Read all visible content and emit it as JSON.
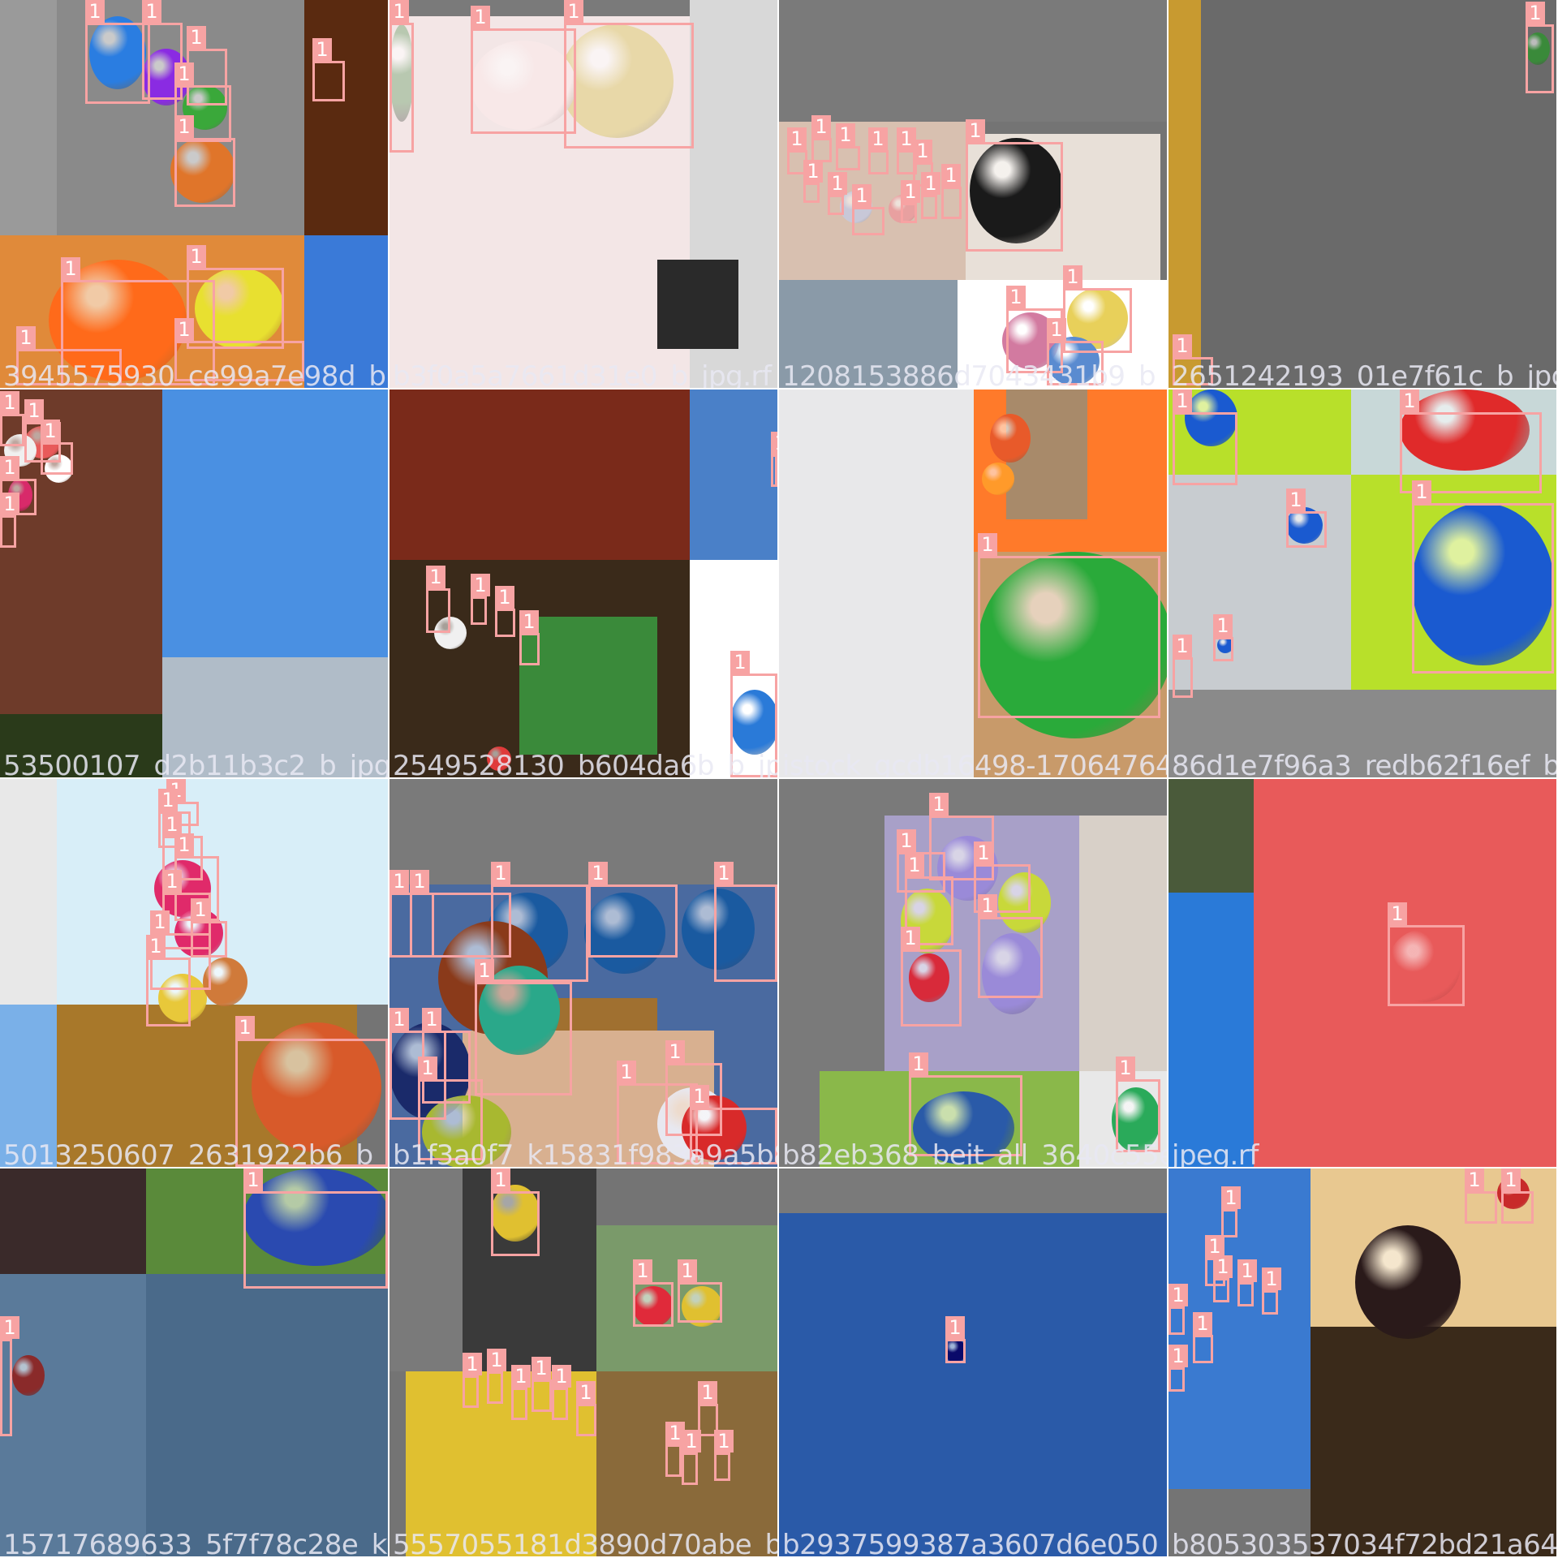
{
  "image_kind": "mosaic-training-batch",
  "box_color": "#f7a3a3",
  "tiles": [
    {
      "filename": "3945575930_ce99a7e98d_b_jpg.rf.4d0ee47a4a582b0c0_b_jpg",
      "label": "1",
      "scene": "bw-room-balloons",
      "colors": [
        "#8a8a8a",
        "#505050",
        "#2a7de1",
        "#8a2be2",
        "#3aa83a",
        "#e0752a"
      ]
    },
    {
      "filename": "b3f0a5a7661d31e0_b_jpg.rf",
      "label": "1",
      "scene": "pale-woman-balloons",
      "colors": [
        "#f3e6e6",
        "#e8d8a8",
        "#b8c8b0"
      ]
    },
    {
      "filename": "1208153886d7043431b9_b_jpg.rf",
      "label": "1",
      "scene": "kids-balloons-party",
      "colors": [
        "#1a1a1a",
        "#e8e0d0",
        "#d27aa0",
        "#e8d05a",
        "#5a8bd0"
      ]
    },
    {
      "filename": "2651242193_01e7f61c_b_jpg",
      "label": "1",
      "scene": "bw-rail-bridge",
      "colors": [
        "#3a3a3a",
        "#6a6a6a",
        "#c89a30"
      ]
    },
    {
      "filename": "53500107_d2b11b3c2_b_jpg.rf.",
      "label": "1",
      "scene": "brick-wall-sky",
      "colors": [
        "#6e3b2a",
        "#4a90e2",
        "#d8d8d8"
      ]
    },
    {
      "filename": "2549528130_b604da6b_b_jpg.rf",
      "label": "1",
      "scene": "party-brick-window",
      "colors": [
        "#7a2a1a",
        "#3a2a1a",
        "#e03a3a",
        "#3a8a3a"
      ]
    },
    {
      "filename": "istock_gcdb16498-1706476485_jpg",
      "label": "1",
      "scene": "stairs-dog-balloons",
      "colors": [
        "#e8e8ea",
        "#ff7a2a",
        "#2a9a3a",
        "#c89a6a"
      ]
    },
    {
      "filename": "86d1e7f96a3_redb62f16ef_b_jpg",
      "label": "1",
      "scene": "green-blue-balloons",
      "colors": [
        "#b8e02a",
        "#1a5ad0",
        "#e02a2a",
        "#c8ccd0"
      ]
    },
    {
      "filename": "5013250607_2631922b6_b_jpg.rf",
      "label": "1",
      "scene": "sky-color-balloons",
      "colors": [
        "#d8eef8",
        "#e02a6a",
        "#7ab0e8",
        "#d07a3a"
      ]
    },
    {
      "filename": "b1f3a0f7_k15831f983a9a5b82eb368_b_jpg",
      "label": "1",
      "scene": "balloon-pile-girls",
      "colors": [
        "#1a5aa0",
        "#2aa88a",
        "#8a3a1a",
        "#a8b830"
      ]
    },
    {
      "filename": "b82eb368_beit_all_3640c55ed_jpeg.rf",
      "label": "1",
      "scene": "child-purple-balloons",
      "colors": [
        "#9a8ad8",
        "#c8d83a",
        "#6a6a6a",
        "#2a5aa8"
      ]
    },
    {
      "filename": "jpeg.rf",
      "label": "1",
      "scene": "wall-red-balloon",
      "colors": [
        "#4a5a3a",
        "#e85a5a",
        "#2a8ad0"
      ]
    },
    {
      "filename": "15717689633_5f7f78c28e_k",
      "label": "1",
      "scene": "ocean-blue-balloon",
      "colors": [
        "#5a7a9a",
        "#2a4ab0",
        "#8a3a3a"
      ]
    },
    {
      "filename": "5557055181d3890d70abe_b2937599387a3607d6e050",
      "label": "1",
      "scene": "park-party-balloons",
      "colors": [
        "#e0c030",
        "#3a6aa8",
        "#e02a3a"
      ]
    },
    {
      "filename": "b2937599387a3607d6e050_b",
      "label": "1",
      "scene": "blue-sky-single",
      "colors": [
        "#2a5aa8",
        "#0a0a6a"
      ]
    },
    {
      "filename": "b805303537034f72bd21a64",
      "label": "1",
      "scene": "sky-girls-back",
      "colors": [
        "#3a7ad0",
        "#e8c890",
        "#1a1a1a",
        "#c82a2a"
      ]
    }
  ]
}
